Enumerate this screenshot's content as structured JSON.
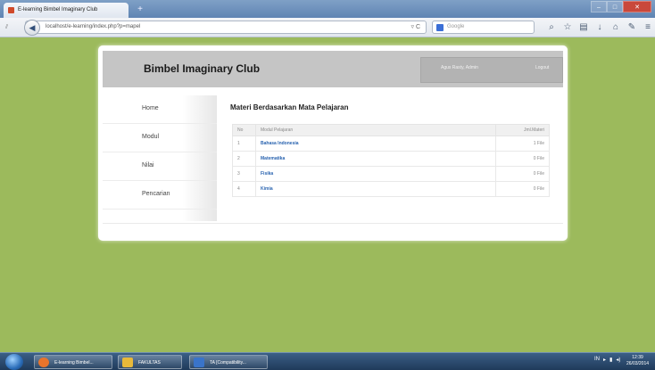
{
  "browser": {
    "tab_title": "E-learning Bimbel Imaginary Club",
    "new_tab_label": "+",
    "url": "localhost/e-learning/index.php?p=mapel",
    "url_host": "localhost",
    "search_placeholder": "Google",
    "window_controls": {
      "minimize": "–",
      "maximize": "□",
      "close": "✕"
    },
    "toolbar_icons": [
      "search-icon",
      "star-icon",
      "bookmark-icon",
      "download-icon",
      "home-icon",
      "tools-icon",
      "menu-icon"
    ]
  },
  "site": {
    "title": "Bimbel Imaginary Club",
    "header_links": [
      "Agus Rasty, Admin",
      "Logout"
    ]
  },
  "sidebar": {
    "items": [
      "Home",
      "Modul",
      "Nilai",
      "Pencarian"
    ]
  },
  "content": {
    "title": "Materi Berdasarkan Mata Pelajaran",
    "table": {
      "headers": [
        "No",
        "Modul Pelajaran",
        "Jml.Materi"
      ],
      "rows": [
        {
          "no": "1",
          "subject": "Bahasa Indonesia",
          "count": "1  File"
        },
        {
          "no": "2",
          "subject": "Matematika",
          "count": "0  File"
        },
        {
          "no": "3",
          "subject": "Fisika",
          "count": "0  File"
        },
        {
          "no": "4",
          "subject": "Kimia",
          "count": "0  File"
        }
      ]
    }
  },
  "taskbar": {
    "tasks": [
      "E-learning Bimbel...",
      "FAKULTAS",
      "TA [Compatibility..."
    ],
    "task_colors": [
      "#e8742c",
      "#e8b93a",
      "#3a74c9"
    ],
    "tray_lang": "IN",
    "time": "12:39",
    "date": "26/03/2014"
  }
}
